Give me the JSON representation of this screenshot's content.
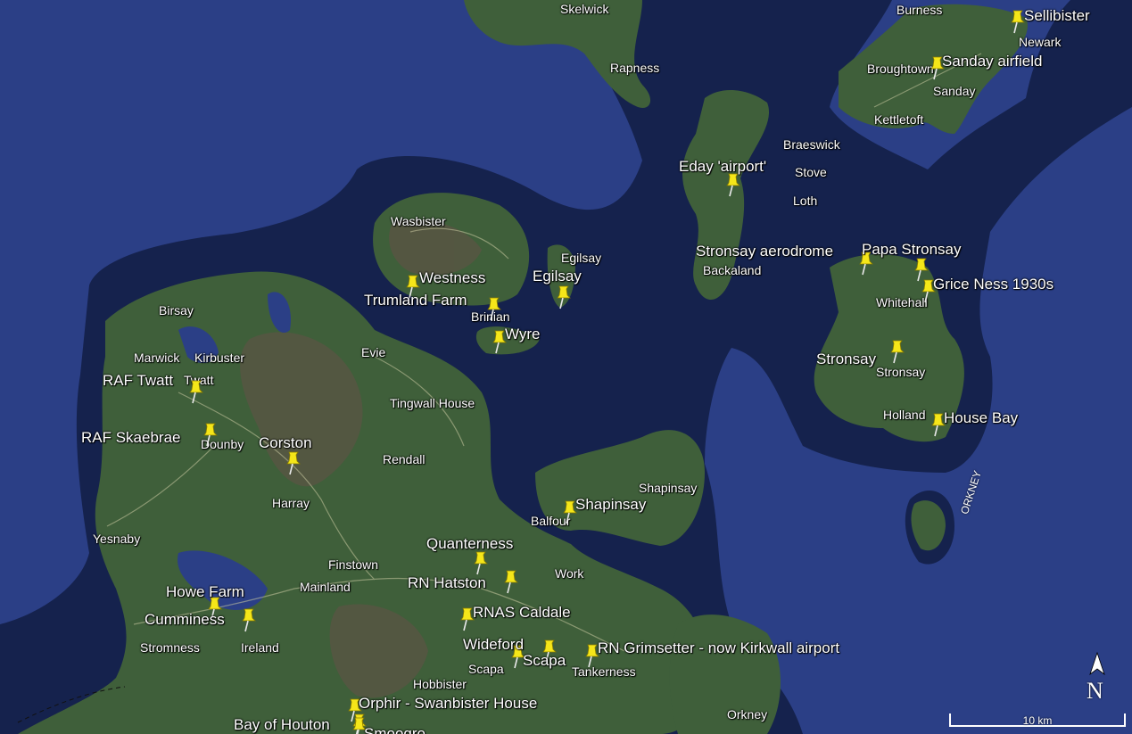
{
  "map": {
    "colors": {
      "sea": "#2b3f86",
      "shallow": "#15224d",
      "land": "#3f5f3a",
      "land_dark": "#2f4a2c",
      "moor": "#5b5444",
      "roads": "#c8c8a0",
      "pin": "#f5e619"
    },
    "place_labels": [
      {
        "id": "skelwick",
        "text": "Skelwick"
      },
      {
        "id": "rapness",
        "text": "Rapness"
      },
      {
        "id": "burness",
        "text": "Burness"
      },
      {
        "id": "newark",
        "text": "Newark"
      },
      {
        "id": "broughtown",
        "text": "Broughtown"
      },
      {
        "id": "sanday",
        "text": "Sanday"
      },
      {
        "id": "kettletoft",
        "text": "Kettletoft"
      },
      {
        "id": "braeswick",
        "text": "Braeswick"
      },
      {
        "id": "stove",
        "text": "Stove"
      },
      {
        "id": "loth",
        "text": "Loth"
      },
      {
        "id": "wasbister",
        "text": "Wasbister"
      },
      {
        "id": "egilsay-town",
        "text": "Egilsay"
      },
      {
        "id": "backaland",
        "text": "Backaland"
      },
      {
        "id": "whitehall",
        "text": "Whitehall"
      },
      {
        "id": "birsay",
        "text": "Birsay"
      },
      {
        "id": "brinian",
        "text": "Brinian"
      },
      {
        "id": "marwick",
        "text": "Marwick"
      },
      {
        "id": "kirbuster",
        "text": "Kirbuster"
      },
      {
        "id": "evie",
        "text": "Evie"
      },
      {
        "id": "twatt",
        "text": "Twatt"
      },
      {
        "id": "stronsay-town",
        "text": "Stronsay"
      },
      {
        "id": "tingwall",
        "text": "Tingwall House"
      },
      {
        "id": "dounby",
        "text": "Dounby"
      },
      {
        "id": "holland",
        "text": "Holland"
      },
      {
        "id": "rendall",
        "text": "Rendall"
      },
      {
        "id": "shapinsay-town",
        "text": "Shapinsay"
      },
      {
        "id": "harray",
        "text": "Harray"
      },
      {
        "id": "balfour",
        "text": "Balfour"
      },
      {
        "id": "yesnaby",
        "text": "Yesnaby"
      },
      {
        "id": "finstown",
        "text": "Finstown"
      },
      {
        "id": "work",
        "text": "Work"
      },
      {
        "id": "mainland",
        "text": "Mainland"
      },
      {
        "id": "stromness",
        "text": "Stromness"
      },
      {
        "id": "ireland",
        "text": "Ireland"
      },
      {
        "id": "scapa-town",
        "text": "Scapa"
      },
      {
        "id": "tankerness",
        "text": "Tankerness"
      },
      {
        "id": "hobbister",
        "text": "Hobbister"
      },
      {
        "id": "orkney-town",
        "text": "Orkney"
      }
    ],
    "markers": [
      {
        "id": "sellibister",
        "label": "Sellibister"
      },
      {
        "id": "sanday-airfield",
        "label": "Sanday airfield"
      },
      {
        "id": "eday-airport",
        "label": "Eday 'airport'"
      },
      {
        "id": "stronsay-aerodrome",
        "label": "Stronsay aerodrome"
      },
      {
        "id": "papa-stronsay",
        "label": "Papa Stronsay"
      },
      {
        "id": "grice-ness",
        "label": "Grice Ness 1930s"
      },
      {
        "id": "westness",
        "label": "Westness"
      },
      {
        "id": "egilsay",
        "label": "Egilsay"
      },
      {
        "id": "trumland-farm",
        "label": "Trumland Farm"
      },
      {
        "id": "wyre",
        "label": "Wyre"
      },
      {
        "id": "stronsay",
        "label": "Stronsay"
      },
      {
        "id": "raf-twatt",
        "label": "RAF Twatt"
      },
      {
        "id": "house-bay",
        "label": "House Bay"
      },
      {
        "id": "raf-skaebrae",
        "label": "RAF Skaebrae"
      },
      {
        "id": "corston",
        "label": "Corston"
      },
      {
        "id": "shapinsay",
        "label": "Shapinsay"
      },
      {
        "id": "quanterness",
        "label": "Quanterness"
      },
      {
        "id": "rn-hatston",
        "label": "RN Hatston"
      },
      {
        "id": "howe-farm",
        "label": "Howe Farm"
      },
      {
        "id": "rnas-caldale",
        "label": "RNAS Caldale"
      },
      {
        "id": "cumminess",
        "label": "Cumminess"
      },
      {
        "id": "wideford",
        "label": "Wideford"
      },
      {
        "id": "scapa",
        "label": "Scapa"
      },
      {
        "id": "rn-grimsetter",
        "label": "RN Grimsetter - now Kirkwall airport"
      },
      {
        "id": "orphir",
        "label": "Orphir - Swanbister House"
      },
      {
        "id": "bay-of-houton",
        "label": "Bay of Houton"
      },
      {
        "id": "smoogro",
        "label": "Smoogro"
      }
    ],
    "region_label": "ORKNEY",
    "compass_label": "N",
    "scale_label": "10 km"
  }
}
